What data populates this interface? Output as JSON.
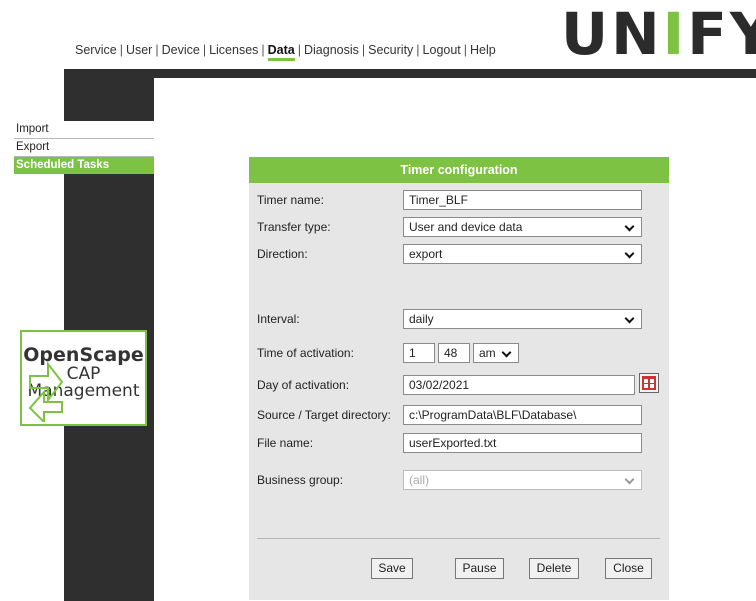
{
  "header": {
    "nav": [
      "Service",
      "User",
      "Device",
      "Licenses",
      "Data",
      "Diagnosis",
      "Security",
      "Logout",
      "Help"
    ],
    "active": "Data",
    "logo": {
      "before": "UN",
      "bar": "I",
      "after": "FY"
    }
  },
  "sidebar": {
    "items": [
      {
        "label": "Import"
      },
      {
        "label": "Export"
      },
      {
        "label": "Scheduled Tasks",
        "active": true
      }
    ],
    "product_logo": {
      "line1": "OpenScape",
      "line2": "CAP",
      "line3": "Management"
    }
  },
  "dialog": {
    "title": "Timer configuration",
    "fields": {
      "timer_name": {
        "label": "Timer name:",
        "value": "Timer_BLF"
      },
      "transfer_type": {
        "label": "Transfer type:",
        "value": "User and device data"
      },
      "direction": {
        "label": "Direction:",
        "value": "export"
      },
      "interval": {
        "label": "Interval:",
        "value": "daily"
      },
      "time_of_activation": {
        "label": "Time of activation:",
        "hour": "1",
        "minute": "48",
        "ampm": "am"
      },
      "day_of_activation": {
        "label": "Day of activation:",
        "value": "03/02/2021"
      },
      "directory": {
        "label": "Source / Target directory:",
        "value": "c:\\ProgramData\\BLF\\Database\\"
      },
      "file_name": {
        "label": "File name:",
        "value": "userExported.txt"
      },
      "business_group": {
        "label": "Business group:",
        "value": "(all)",
        "disabled": true
      }
    },
    "buttons": {
      "save": "Save",
      "pause": "Pause",
      "delete": "Delete",
      "close": "Close"
    }
  },
  "colors": {
    "accent": "#7dc242",
    "dark": "#2f2f2f",
    "dialog_bg": "#e6e6e6"
  },
  "icons": {
    "calendar": "calendar-icon"
  }
}
